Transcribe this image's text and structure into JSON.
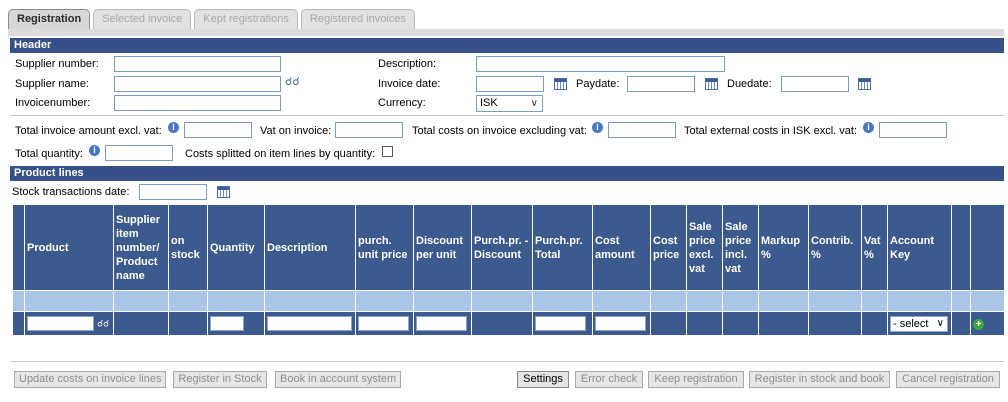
{
  "tabs": [
    "Registration",
    "Selected invoice",
    "Kept registrations",
    "Registered invoices"
  ],
  "header": {
    "title": "Header",
    "supplier_number_label": "Supplier number:",
    "supplier_name_label": "Supplier name:",
    "invoicenumber_label": "Invoicenumber:",
    "description_label": "Description:",
    "invoice_date_label": "Invoice date:",
    "paydate_label": "Paydate:",
    "duedate_label": "Duedate:",
    "currency_label": "Currency:",
    "currency_value": "ISK"
  },
  "totals": {
    "total_excl_vat_label": "Total invoice amount excl. vat:",
    "vat_on_invoice_label": "Vat on invoice:",
    "total_costs_label": "Total costs on invoice excluding vat:",
    "total_external_label": "Total external costs in ISK excl. vat:",
    "total_quantity_label": "Total quantity:",
    "costs_splitted_label": "Costs splitted on item lines by quantity:"
  },
  "product_lines": {
    "title": "Product lines",
    "stock_date_label": "Stock transactions date:",
    "columns": [
      "Product",
      "Supplier item number/ Product name",
      "on stock",
      "Quantity",
      "Description",
      "purch. unit price",
      "Discount per unit",
      "Purch.pr. - Discount",
      "Purch.pr. Total",
      "Cost amount",
      "Cost price",
      "Sale price excl. vat",
      "Sale price incl. vat",
      "Markup %",
      "Contrib. %",
      "Vat %",
      "Account Key",
      "",
      ""
    ],
    "account_key_select": "- select"
  },
  "buttons": {
    "update_costs": "Update costs on invoice lines",
    "register_stock": "Register in Stock",
    "book_account": "Book in account system",
    "settings": "Settings",
    "error_check": "Error check",
    "keep_registration": "Keep registration",
    "register_stock_book": "Register in stock and book",
    "cancel_registration": "Cancel registration"
  }
}
